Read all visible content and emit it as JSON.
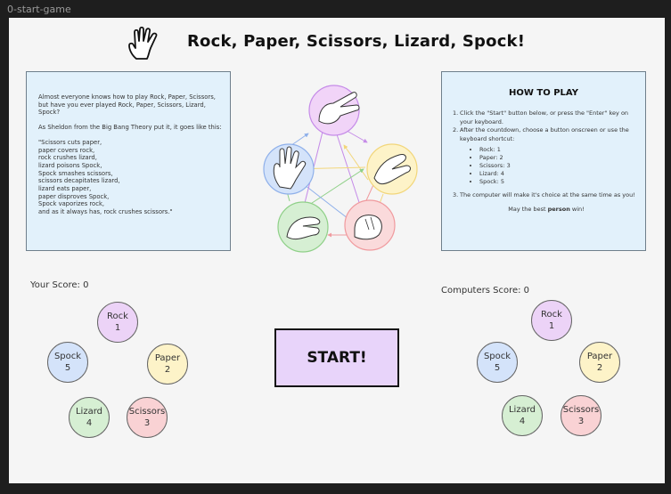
{
  "frame_label": "0-start-game",
  "title": "Rock, Paper, Scissors, Lizard, Spock!",
  "intro": {
    "p1": "Almost everyone knows how to play Rock, Paper, Scissors, but have you ever played Rock, Paper, Scissors, Lizard, Spock?",
    "p2": "As Sheldon from the Big Bang Theory put it, it goes like this:",
    "quote_lines": [
      "\"Scissors cuts paper,",
      "paper covers rock,",
      "rock crushes lizard,",
      "lizard poisons Spock,",
      "Spock smashes scissors,",
      "scissors decapitates lizard,",
      "lizard eats paper,",
      "paper disproves Spock,",
      "Spock vaporizes rock,",
      "and as it always has, rock crushes scissors.\""
    ]
  },
  "how_to_play": {
    "title": "HOW TO PLAY",
    "step1": "Click the \"Start\" button below, or press the \"Enter\" key on your keyboard.",
    "step2": "After the countdown, choose a button onscreen or use the keyboard shortcut:",
    "shortcuts": [
      "Rock: 1",
      "Paper: 2",
      "Scissors: 3",
      "Lizard: 4",
      "Spock: 5"
    ],
    "step3": "The computer will make it's choice at the same time as you!",
    "bless_prefix": "May the best ",
    "bless_bold": "person",
    "bless_suffix": " win!"
  },
  "player": {
    "score_label": "Your Score: 0",
    "choices": {
      "rock": {
        "name": "Rock",
        "key": "1"
      },
      "paper": {
        "name": "Paper",
        "key": "2"
      },
      "scissors": {
        "name": "Scissors",
        "key": "3"
      },
      "lizard": {
        "name": "Lizard",
        "key": "4"
      },
      "spock": {
        "name": "Spock",
        "key": "5"
      }
    }
  },
  "computer": {
    "score_label": "Computers Score: 0",
    "choices": {
      "rock": {
        "name": "Rock",
        "key": "1"
      },
      "paper": {
        "name": "Paper",
        "key": "2"
      },
      "scissors": {
        "name": "Scissors",
        "key": "3"
      },
      "lizard": {
        "name": "Lizard",
        "key": "4"
      },
      "spock": {
        "name": "Spock",
        "key": "5"
      }
    }
  },
  "start_label": "START!",
  "colors": {
    "rock": "#ecd3f7",
    "paper": "#fdf3c8",
    "scissors": "#f9d2d4",
    "lizard": "#d6efd3",
    "spock": "#d4e3fa",
    "panel": "#e2f1fb",
    "start": "#e8d4fa"
  }
}
